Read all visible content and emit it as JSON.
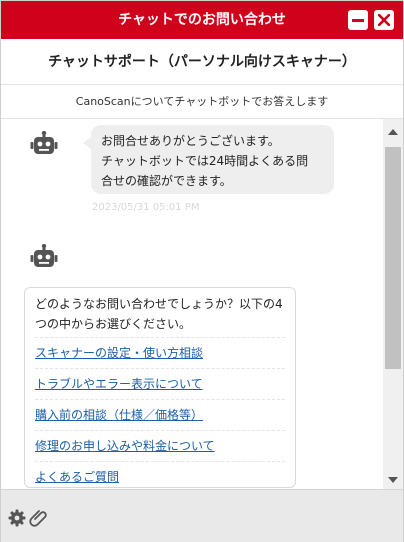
{
  "window": {
    "title": "チャットでのお問い合わせ",
    "accent_color": "#d0021b"
  },
  "header": {
    "subtitle": "チャットサポート（パーソナル向けスキャナー）",
    "notice": "CanoScanについてチャットボットでお答えします"
  },
  "messages": [
    {
      "sender": "bot",
      "text": "お問合せありがとうございます。\nチャットボットでは24時間よくある問\n合せの確認ができます。",
      "timestamp": "2023/05/31 05:01 PM"
    }
  ],
  "menu": {
    "prompt": "どのようなお問い合わせでしょうか？以下の4つの中からお選びください。",
    "items": [
      "スキャナーの設定・使い方相談",
      "トラブルやエラー表示について",
      "購入前の相談（仕様／価格等）",
      "修理のお申し込みや料金について",
      "よくあるご質問"
    ]
  },
  "icons": {
    "minimize": "minimize-icon",
    "close": "close-icon",
    "bot": "robot-icon",
    "settings": "gear-icon",
    "attach": "paperclip-icon"
  }
}
